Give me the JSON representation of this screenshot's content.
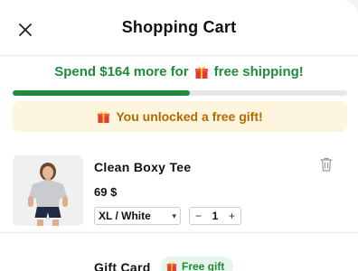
{
  "header": {
    "title": "Shopping Cart"
  },
  "shipping": {
    "message_prefix": "Spend $164 more for",
    "message_suffix": "free shipping!",
    "progress_fraction": 0.53
  },
  "gift_banner": {
    "text": "You unlocked a free gift!"
  },
  "items": [
    {
      "name": "Clean Boxy Tee",
      "price": "69 $",
      "variant": "XL / White",
      "quantity": "1",
      "decrement_label": "−",
      "increment_label": "+"
    },
    {
      "name": "Gift Card",
      "badge": "Free gift"
    }
  ],
  "colors": {
    "accent_green": "#1e8c3a",
    "banner_bg": "#fdf5de",
    "banner_text": "#b26a00"
  },
  "icons": {
    "close": "close-icon",
    "gift": "gift-icon",
    "trash": "trash-icon",
    "chevron": "chevron-down-icon"
  }
}
